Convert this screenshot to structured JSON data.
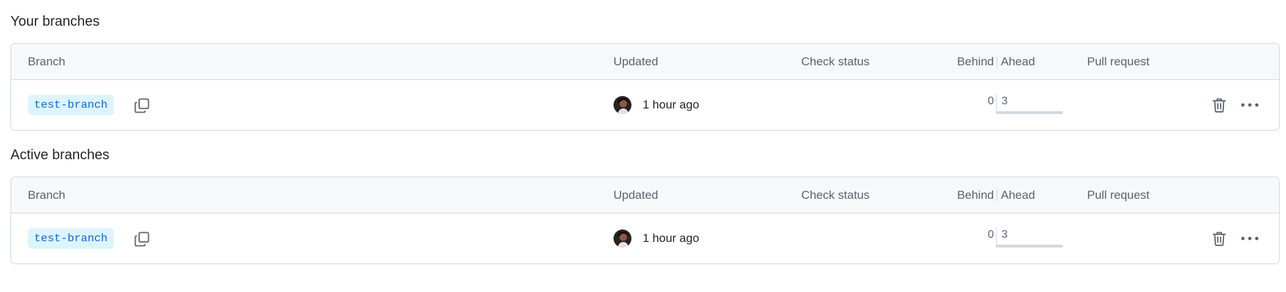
{
  "sections": [
    {
      "title": "Your branches",
      "headers": {
        "branch": "Branch",
        "updated": "Updated",
        "check_status": "Check status",
        "behind": "Behind",
        "ahead": "Ahead",
        "pull_request": "Pull request"
      },
      "rows": [
        {
          "branch": "test-branch",
          "updated": "1 hour ago",
          "behind": "0",
          "ahead": "3",
          "ahead_fraction": 1.0
        }
      ]
    },
    {
      "title": "Active branches",
      "headers": {
        "branch": "Branch",
        "updated": "Updated",
        "check_status": "Check status",
        "behind": "Behind",
        "ahead": "Ahead",
        "pull_request": "Pull request"
      },
      "rows": [
        {
          "branch": "test-branch",
          "updated": "1 hour ago",
          "behind": "0",
          "ahead": "3",
          "ahead_fraction": 1.0
        }
      ]
    }
  ],
  "icons": {
    "copy": "copy-icon",
    "delete": "trash-icon",
    "more": "kebab-horizontal-icon",
    "avatar": "user-avatar"
  },
  "colors": {
    "branch_text": "#0969da",
    "branch_bg": "#ddf4ff",
    "header_bg": "#f6f8fa",
    "border": "#d1d9e0",
    "muted_text": "#59636e"
  }
}
